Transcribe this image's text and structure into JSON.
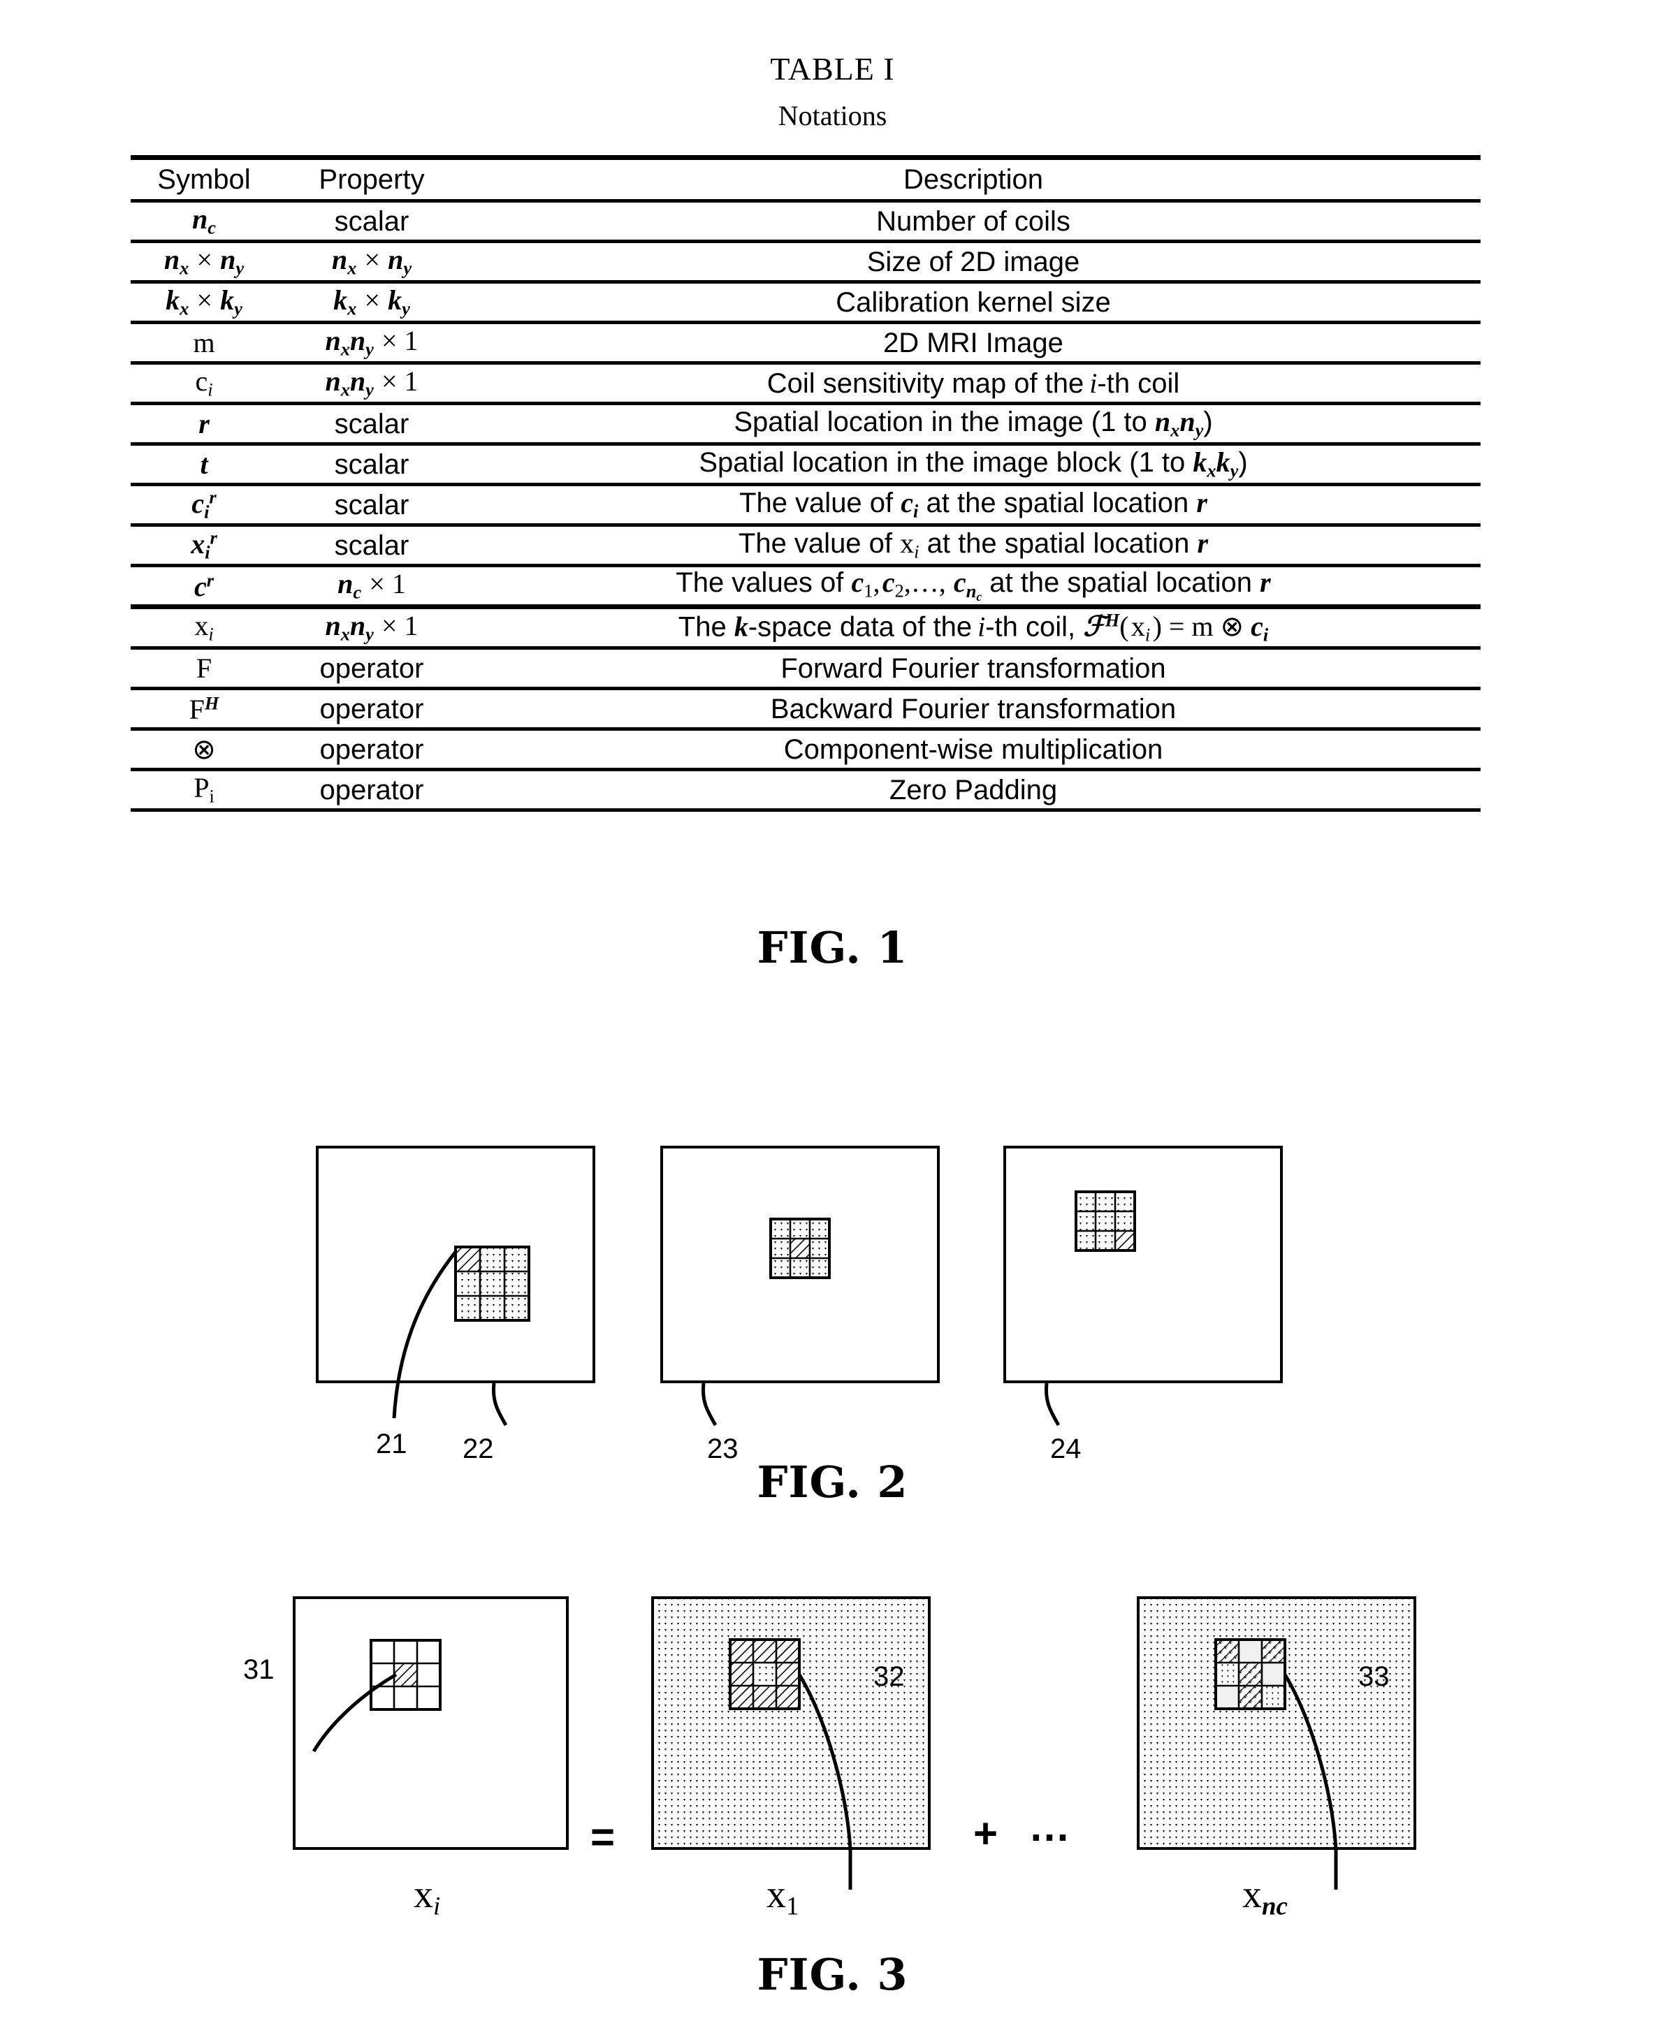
{
  "table": {
    "title": "TABLE I",
    "subtitle": "Notations",
    "headers": [
      "Symbol",
      "Property",
      "Description"
    ],
    "rows": [
      {
        "symbol_html": "<span class='mi'>n<span class='sub'>c</span></span>",
        "property_html": "scalar",
        "description_html": "Number of coils",
        "symbol_text": "n_c",
        "property_text": "scalar",
        "description_text": "Number of coils"
      },
      {
        "symbol_html": "<span class='mi'>n<span class='sub'>x</span></span> <span class='mr'>&#215;</span> <span class='mi'>n<span class='sub'>y</span></span>",
        "property_html": "<span class='mi'>n<span class='sub'>x</span></span> <span class='mr'>&#215;</span> <span class='mi'>n<span class='sub'>y</span></span>",
        "description_html": "Size of 2D image",
        "symbol_text": "n_x × n_y",
        "property_text": "n_x × n_y",
        "description_text": "Size of 2D image"
      },
      {
        "symbol_html": "<span class='mi'>k<span class='sub'>x</span></span> <span class='mr'>&#215;</span> <span class='mi'>k<span class='sub'>y</span></span>",
        "property_html": "<span class='mi'>k<span class='sub'>x</span></span> <span class='mr'>&#215;</span> <span class='mi'>k<span class='sub'>y</span></span>",
        "description_html": "Calibration kernel size",
        "symbol_text": "k_x × k_y",
        "property_text": "k_x × k_y",
        "description_text": "Calibration kernel size"
      },
      {
        "symbol_html": "<span class='mr'>m</span>",
        "property_html": "<span class='mi'>n<span class='sub'>x</span>n<span class='sub'>y</span></span> <span class='mr'>&#215; 1</span>",
        "description_html": "2D MRI Image",
        "symbol_text": "m",
        "property_text": "n_x n_y × 1",
        "description_text": "2D MRI Image"
      },
      {
        "symbol_html": "<span class='mr'>c<span class='sub mii'>i</span></span>",
        "property_html": "<span class='mi'>n<span class='sub'>x</span>n<span class='sub'>y</span></span> <span class='mr'>&#215; 1</span>",
        "description_html": "Coil sensitivity map of the<span class='mii'>&#8201;i</span>-th coil",
        "symbol_text": "c_i",
        "property_text": "n_x n_y × 1",
        "description_text": "Coil sensitivity map of the i-th coil"
      },
      {
        "symbol_html": "<span class='mi'>r</span>",
        "property_html": "scalar",
        "description_html": "Spatial location in the image (1 to <span class='mi'>n<span class='sub'>x</span>n<span class='sub'>y</span></span>)",
        "symbol_text": "r",
        "property_text": "scalar",
        "description_text": "Spatial location in the image (1 to n_x n_y)"
      },
      {
        "symbol_html": "<span class='mi'>t</span>",
        "property_html": "scalar",
        "description_html": "Spatial location in the image block (1 to <span class='mi'>k<span class='sub'>x</span>k<span class='sub'>y</span></span>)",
        "symbol_text": "t",
        "property_text": "scalar",
        "description_text": "Spatial location in the image block (1 to k_x k_y)"
      },
      {
        "symbol_html": "<span class='mi'>c<span class='sub'>i</span><span class='sup'>r</span></span>",
        "property_html": "scalar",
        "description_html": "The value of <span class='mi'>c<span class='sub'>i</span></span> at the spatial location <span class='mi'>r</span>",
        "symbol_text": "c_i^r",
        "property_text": "scalar",
        "description_text": "The value of c_i at the spatial location r"
      },
      {
        "symbol_html": "<span class='mi'>x<span class='sub'>i</span><span class='sup'>r</span></span>",
        "property_html": "scalar",
        "description_html": "The value of <span class='mr'>x<span class='sub mii'>i</span></span> at the spatial location <span class='mi'>r</span>",
        "symbol_text": "x_i^r",
        "property_text": "scalar",
        "description_text": "The value of x_i at the spatial location r"
      },
      {
        "symbol_html": "<span class='mi'>c<span class='sup'>r</span></span>",
        "property_html": "<span class='mi'>n<span class='sub'>c</span></span> <span class='mr'>&#215; 1</span>",
        "description_html": "The values of <span class='mi'>c</span><span class='mr sub'>1</span><span class='mr'>,&#8202;</span><span class='mi'>c</span><span class='mr sub'>2</span><span class='mr'>,&#8230;,</span> <span class='mi'>c<span class='sub'>n<span class='sub'>c</span></span></span> at the spatial location <span class='mi'>r</span>",
        "symbol_text": "c^r",
        "property_text": "n_c × 1",
        "description_text": "The values of c_1, c_2, ..., c_{n_c} at the spatial location r"
      },
      {
        "symbol_html": "<span class='mr'>x<span class='sub mii'>i</span></span>",
        "property_html": "<span class='mi'>n<span class='sub'>x</span>n<span class='sub'>y</span></span> <span class='mr'>&#215; 1</span>",
        "description_html": "The <span class='mi'>k</span>-space data of the<span class='mii'>&#8201;i</span>-th coil, <span class='scr'>&#8497;<span class='sup'>H</span></span><span class='mr'>(&#8202;x<span class='sub mii'>i</span>&#8202;) = m &#8855; </span><span class='mi'>c<span class='sub'>i</span></span>",
        "symbol_text": "x_i",
        "property_text": "n_x n_y × 1",
        "description_text": "The k-space data of the i-th coil, F^H(x_i) = m ⊗ c_i"
      },
      {
        "symbol_html": "<span class='mr'>F</span>",
        "property_html": "operator",
        "description_html": "Forward Fourier transformation",
        "symbol_text": "F",
        "property_text": "operator",
        "description_text": "Forward Fourier transformation"
      },
      {
        "symbol_html": "<span class='mr'>F<span class='sup mi'>H</span></span>",
        "property_html": "operator",
        "description_html": "Backward Fourier transformation",
        "symbol_text": "F^H",
        "property_text": "operator",
        "description_text": "Backward Fourier transformation"
      },
      {
        "symbol_html": "<span class='mr'>&#8855;</span>",
        "property_html": "operator",
        "description_html": "Component-wise multiplication",
        "symbol_text": "⊗",
        "property_text": "operator",
        "description_text": "Component-wise multiplication"
      },
      {
        "symbol_html": "<span class='mr'>P<span class='sub'>i</span></span>",
        "property_html": "operator",
        "description_html": "Zero Padding",
        "symbol_text": "P_i",
        "property_text": "operator",
        "description_text": "Zero Padding"
      }
    ],
    "group_break_after_row": 10
  },
  "figures": {
    "fig1_caption": "FIG. 1",
    "fig2_caption": "FIG. 2",
    "fig3_caption": "FIG. 3",
    "fig2": {
      "refs": [
        "21",
        "22",
        "23",
        "24"
      ],
      "panels": [
        {
          "ref": "22",
          "hatched_cell_index": 0,
          "fill": "dots",
          "note": "image block with hatched top-left cell"
        },
        {
          "ref": "23",
          "hatched_cell_index": 4,
          "fill": "dots",
          "note": "image block with hatched center cell"
        },
        {
          "ref": "24",
          "hatched_cell_index": 8,
          "fill": "dots",
          "note": "image block with hatched bottom-right cell"
        }
      ]
    },
    "fig3": {
      "equals_sign": "=",
      "plus_sign": "+",
      "ellipsis": "…",
      "refs": [
        "31",
        "32",
        "33"
      ],
      "panels": [
        {
          "label": "x_i",
          "label_base": "x",
          "label_sub": "i",
          "ref": "31",
          "background": "white",
          "grid_fill": "white",
          "hatched_cell_index": 4
        },
        {
          "label": "x_1",
          "label_base": "x",
          "label_sub": "1",
          "ref": "32",
          "background": "dots",
          "grid_fill": "hatch",
          "hatched_cell_index": 4
        },
        {
          "label": "x_nc",
          "label_base": "x",
          "label_sub": "nc",
          "ref": "33",
          "background": "dots",
          "grid_fill": "dots",
          "hatched_cell_index": 4
        }
      ]
    }
  },
  "colors": {
    "ink": "#000000",
    "paper": "#ffffff",
    "pattern": "#000000"
  }
}
